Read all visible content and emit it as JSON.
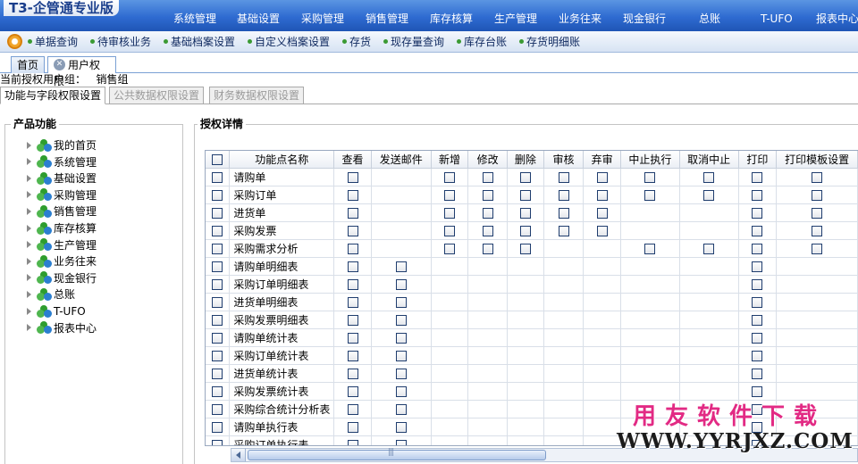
{
  "app": {
    "title": "T3-企管通专业版"
  },
  "main_menu": [
    "系统管理",
    "基础设置",
    "采购管理",
    "销售管理",
    "库存核算",
    "生产管理",
    "业务往来",
    "现金银行",
    "总账",
    "T-UFO",
    "报表中心"
  ],
  "quick_bar": [
    "单据查询",
    "待审核业务",
    "基础档案设置",
    "自定义档案设置",
    "存货",
    "现存量查询",
    "库存台账",
    "存货明细账"
  ],
  "page_tabs": [
    "首页",
    "用户权限"
  ],
  "group": {
    "label": "当前授权用户组：",
    "value": "销售组"
  },
  "sub_tabs": [
    "功能与字段权限设置",
    "公共数据权限设置",
    "财务数据权限设置"
  ],
  "left_panel": {
    "title": "产品功能",
    "items": [
      "我的首页",
      "系统管理",
      "基础设置",
      "采购管理",
      "销售管理",
      "库存核算",
      "生产管理",
      "业务往来",
      "现金银行",
      "总账",
      "T-UFO",
      "报表中心"
    ]
  },
  "right_panel": {
    "title": "授权详情",
    "columns": [
      "功能点名称",
      "查看",
      "发送邮件",
      "新增",
      "修改",
      "删除",
      "审核",
      "弃审",
      "中止执行",
      "取消中止",
      "打印",
      "打印模板设置"
    ],
    "rows": [
      {
        "name": "请购单",
        "checks": [
          1,
          0,
          1,
          1,
          1,
          1,
          1,
          1,
          1,
          1,
          1
        ]
      },
      {
        "name": "采购订单",
        "checks": [
          1,
          0,
          1,
          1,
          1,
          1,
          1,
          1,
          1,
          1,
          1
        ]
      },
      {
        "name": "进货单",
        "checks": [
          1,
          0,
          1,
          1,
          1,
          1,
          1,
          0,
          0,
          1,
          1
        ]
      },
      {
        "name": "采购发票",
        "checks": [
          1,
          0,
          1,
          1,
          1,
          1,
          1,
          0,
          0,
          1,
          1
        ]
      },
      {
        "name": "采购需求分析",
        "checks": [
          1,
          0,
          1,
          1,
          1,
          0,
          0,
          1,
          1,
          1,
          1
        ]
      },
      {
        "name": "请购单明细表",
        "checks": [
          1,
          1,
          0,
          0,
          0,
          0,
          0,
          0,
          0,
          1,
          0
        ]
      },
      {
        "name": "采购订单明细表",
        "checks": [
          1,
          1,
          0,
          0,
          0,
          0,
          0,
          0,
          0,
          1,
          0
        ]
      },
      {
        "name": "进货单明细表",
        "checks": [
          1,
          1,
          0,
          0,
          0,
          0,
          0,
          0,
          0,
          1,
          0
        ]
      },
      {
        "name": "采购发票明细表",
        "checks": [
          1,
          1,
          0,
          0,
          0,
          0,
          0,
          0,
          0,
          1,
          0
        ]
      },
      {
        "name": "请购单统计表",
        "checks": [
          1,
          1,
          0,
          0,
          0,
          0,
          0,
          0,
          0,
          1,
          0
        ]
      },
      {
        "name": "采购订单统计表",
        "checks": [
          1,
          1,
          0,
          0,
          0,
          0,
          0,
          0,
          0,
          1,
          0
        ]
      },
      {
        "name": "进货单统计表",
        "checks": [
          1,
          1,
          0,
          0,
          0,
          0,
          0,
          0,
          0,
          1,
          0
        ]
      },
      {
        "name": "采购发票统计表",
        "checks": [
          1,
          1,
          0,
          0,
          0,
          0,
          0,
          0,
          0,
          1,
          0
        ]
      },
      {
        "name": "采购综合统计分析表",
        "checks": [
          1,
          1,
          0,
          0,
          0,
          0,
          0,
          0,
          0,
          1,
          0
        ]
      },
      {
        "name": "请购单执行表",
        "checks": [
          1,
          1,
          0,
          0,
          0,
          0,
          0,
          0,
          0,
          1,
          0
        ]
      },
      {
        "name": "采购订单执行表",
        "checks": [
          1,
          1,
          0,
          0,
          0,
          0,
          0,
          0,
          0,
          1,
          0
        ]
      }
    ]
  },
  "watermark": {
    "line1": "用友软件下载",
    "line2": "WWW.YYRJXZ.COM"
  }
}
